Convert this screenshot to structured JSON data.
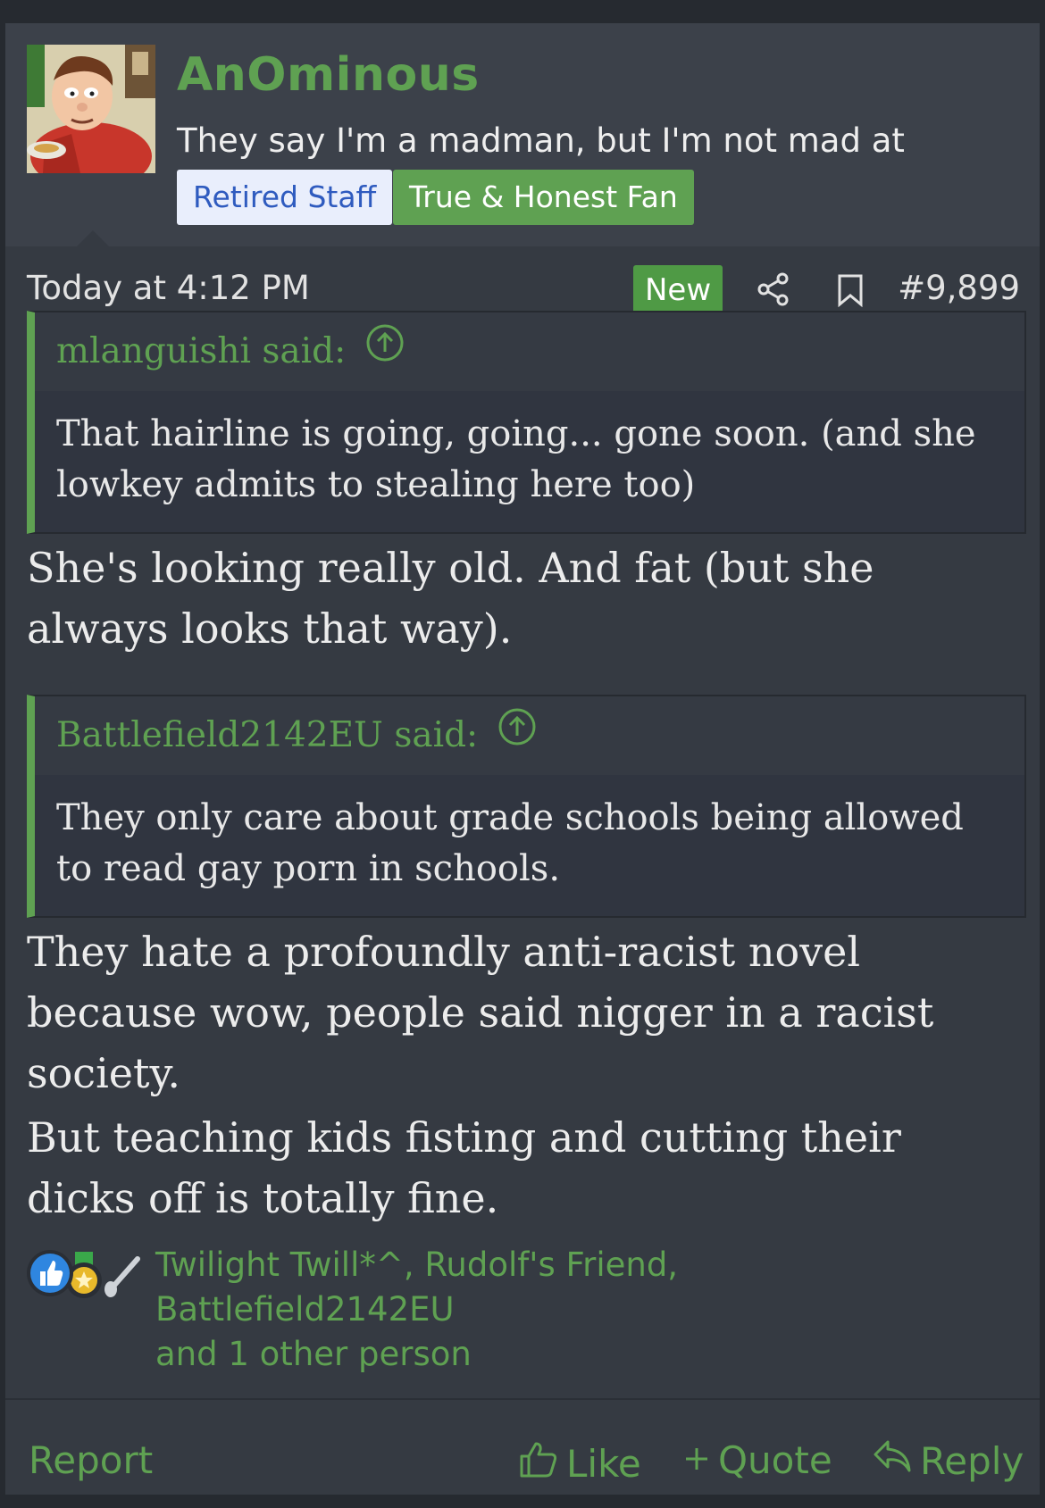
{
  "author": {
    "name": "AnOminous",
    "title": "They say I'm a madman, but I'm not mad at anyone.",
    "badges": [
      "Retired Staff",
      "True & Honest Fan"
    ]
  },
  "meta": {
    "timestamp": "Today at 4:12 PM",
    "new_label": "New",
    "post_number": "#9,899"
  },
  "quotes": [
    {
      "attribution": "mlanguishi said:",
      "text": "That hairline is going, going... gone soon. (and she lowkey admits to stealing here too)"
    },
    {
      "attribution": "Battlefield2142EU said:",
      "text": "They only care about grade schools being allowed to read gay porn in schools."
    }
  ],
  "body": {
    "paragraph1": "She's looking really old. And fat (but she always looks that way).",
    "paragraph2": "They hate a profoundly anti-racist novel because wow, people said nigger in a racist society.",
    "paragraph3": "But teaching kids fisting and cutting their dicks off is totally fine."
  },
  "reactions": {
    "names": "Twilight Twill*^, Rudolf's Friend, Battlefield2142EU",
    "others": "and 1 other person",
    "icons": [
      "thumbs-up-icon",
      "medal-icon",
      "spoon-icon"
    ]
  },
  "footer": {
    "report": "Report",
    "like": "Like",
    "quote": "Quote",
    "reply": "Reply"
  },
  "colors": {
    "accent": "#5fa152",
    "background": "#353a42"
  }
}
